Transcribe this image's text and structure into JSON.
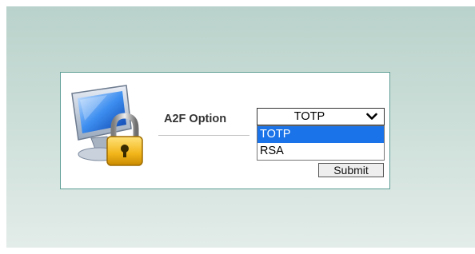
{
  "form": {
    "label": "A2F Option",
    "select": {
      "value": "TOTP",
      "options": [
        "TOTP",
        "RSA"
      ],
      "highlighted_index": 0
    },
    "submit_label": "Submit"
  },
  "icons": {
    "illustration": "computer-lock-icon",
    "select_arrow": "chevron-down-icon"
  },
  "colors": {
    "panel_border": "#5e9e95",
    "background_top": "#b9d2cb",
    "background_bottom": "#e3ece9",
    "highlight": "#1a73e8"
  }
}
